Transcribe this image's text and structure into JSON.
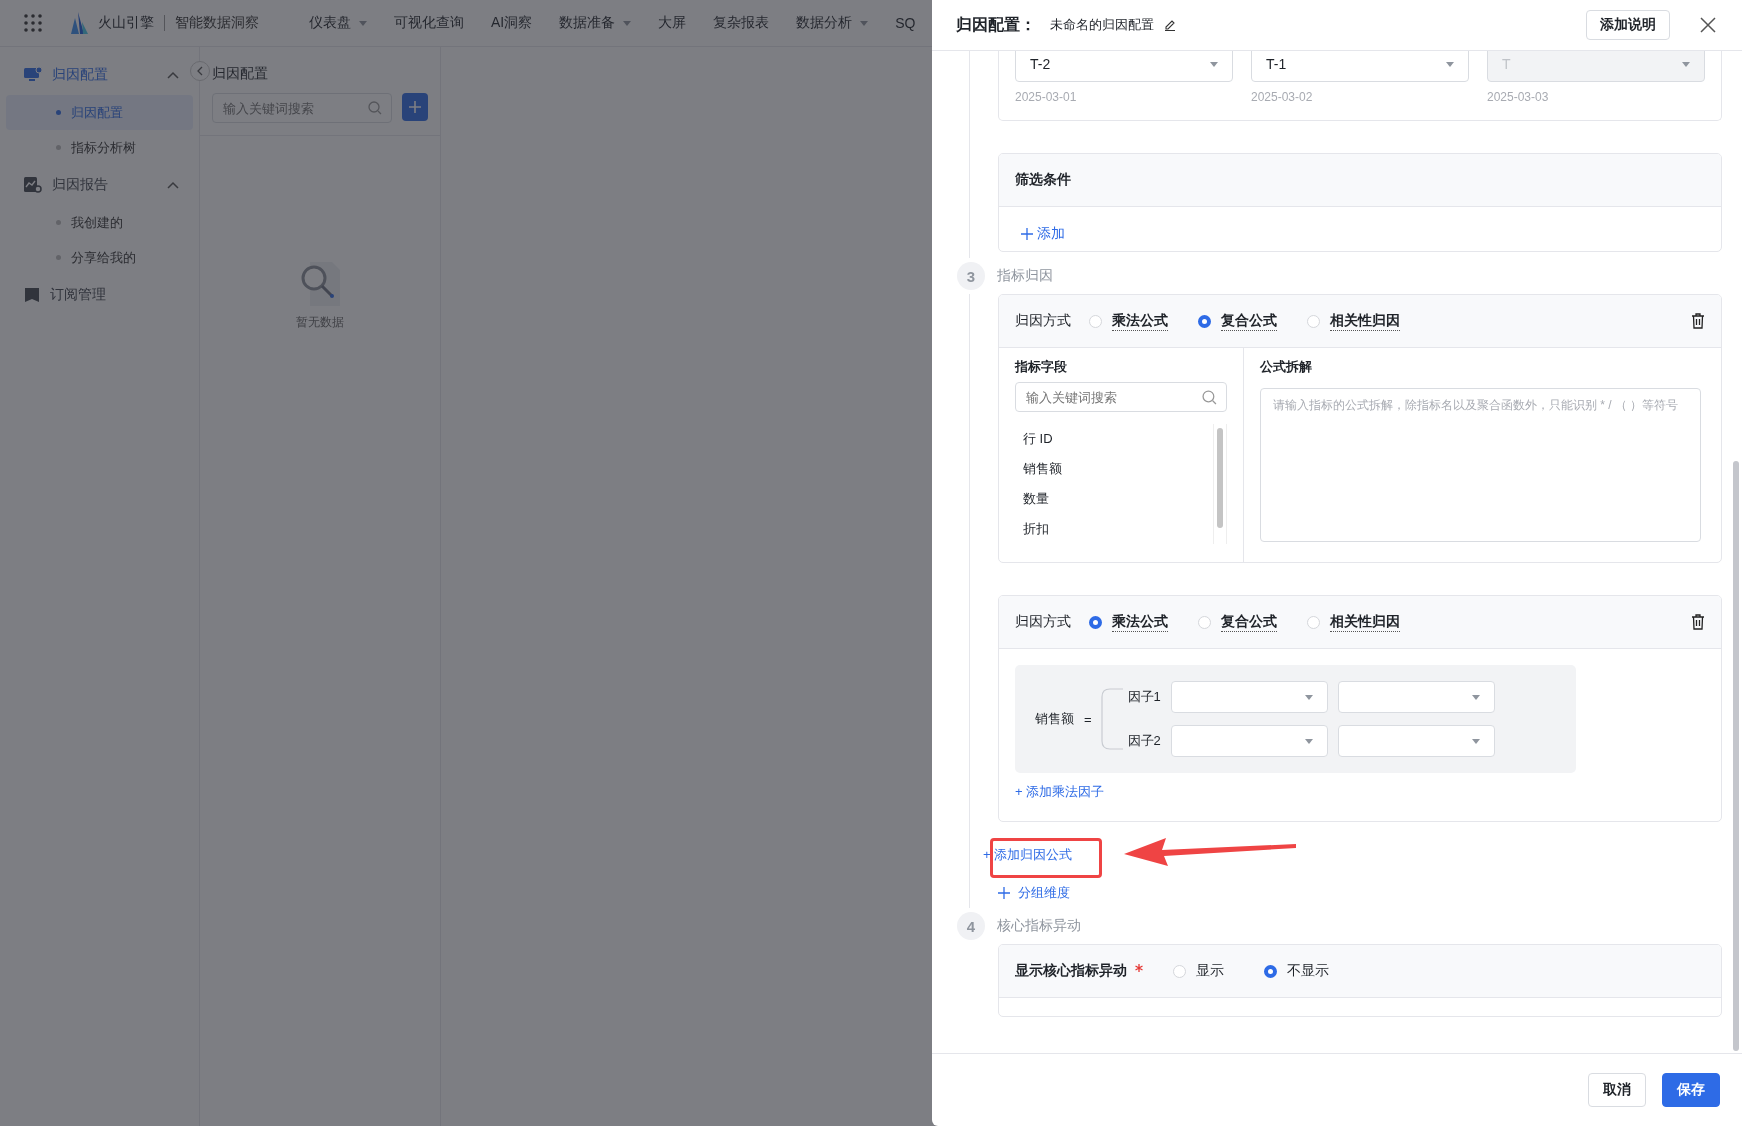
{
  "app": {
    "brand": "火山引擎",
    "product": "智能数据洞察",
    "nav": [
      {
        "label": "仪表盘",
        "dropdown": true
      },
      {
        "label": "可视化查询",
        "dropdown": false
      },
      {
        "label": "AI洞察",
        "dropdown": false
      },
      {
        "label": "数据准备",
        "dropdown": true
      },
      {
        "label": "大屏",
        "dropdown": false
      },
      {
        "label": "复杂报表",
        "dropdown": false
      },
      {
        "label": "数据分析",
        "dropdown": true
      },
      {
        "label": "SQ",
        "dropdown": false
      }
    ],
    "sidebar": [
      {
        "label": "归因配置",
        "expanded": true,
        "selected": true,
        "children": [
          {
            "label": "归因配置",
            "selected": true
          },
          {
            "label": "指标分析树",
            "selected": false
          }
        ]
      },
      {
        "label": "归因报告",
        "expanded": true,
        "selected": false,
        "children": [
          {
            "label": "我创建的",
            "selected": false
          },
          {
            "label": "分享给我的",
            "selected": false
          }
        ]
      },
      {
        "label": "订阅管理",
        "selected": false
      }
    ],
    "panel": {
      "title": "归因配置",
      "search": {
        "placeholder": "输入关键词搜索"
      },
      "empty_text": "暂无数据"
    }
  },
  "drawer": {
    "title": "归因配置：",
    "name": "未命名的归因配置",
    "add_note_button": "添加说明",
    "periods": [
      {
        "value": "T-2",
        "date": "2025-03-01",
        "disabled": false
      },
      {
        "value": "T-1",
        "date": "2025-03-02",
        "disabled": false
      },
      {
        "value": "T",
        "date": "2025-03-03",
        "disabled": true
      }
    ],
    "filter": {
      "title": "筛选条件",
      "add": "添加"
    },
    "step3": {
      "number": "3",
      "title": "指标归因"
    },
    "formulas": [
      {
        "label": "归因方式",
        "kind": "composite",
        "options": [
          {
            "label": "乘法公式",
            "selected": false
          },
          {
            "label": "复合公式",
            "selected": true
          },
          {
            "label": "相关性归因",
            "selected": false
          }
        ],
        "field_label": "指标字段",
        "search": {
          "placeholder": "输入关键词搜索"
        },
        "fields": [
          "行 ID",
          "销售额",
          "数量",
          "折扣"
        ],
        "formula_label": "公式拆解",
        "formula_placeholder": "请输入指标的公式拆解，除指标名以及聚合函数外，只能识别 * / （ ）等符号"
      },
      {
        "label": "归因方式",
        "kind": "multiply",
        "options": [
          {
            "label": "乘法公式",
            "selected": true
          },
          {
            "label": "复合公式",
            "selected": false
          },
          {
            "label": "相关性归因",
            "selected": false
          }
        ],
        "metric": "销售额",
        "equals": "=",
        "factors": [
          "因子1",
          "因子2"
        ],
        "add_factor": "+ 添加乘法因子"
      }
    ],
    "add_formula": "+ 添加归因公式",
    "group_dimension": "分组维度",
    "step4": {
      "number": "4",
      "title": "核心指标异动"
    },
    "anomaly": {
      "label": "显示核心指标异动",
      "required": true,
      "options": [
        {
          "label": "显示",
          "selected": false
        },
        {
          "label": "不显示",
          "selected": true
        }
      ]
    },
    "cancel_button": "取消",
    "save_button": "保存"
  }
}
